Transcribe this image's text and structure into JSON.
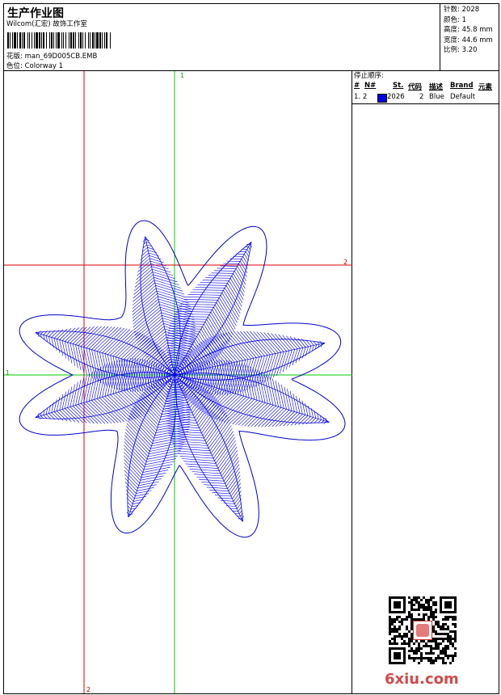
{
  "header": {
    "title": "生产作业图",
    "company": "Wilcom(汇宏) 故饰工作室",
    "design_label": "花版:",
    "design_value": "man_69D005CB.EMB",
    "colorway_label": "色位:",
    "colorway_value": "Colorway 1"
  },
  "specs": [
    {
      "label": "针数:",
      "value": "2028"
    },
    {
      "label": "颜色:",
      "value": "1"
    },
    {
      "label": "高度:",
      "value": "45.8 mm"
    },
    {
      "label": "宽度:",
      "value": "44.6 mm"
    },
    {
      "label": "比例:",
      "value": "3.20"
    }
  ],
  "stop_sequence": {
    "title": "停止顺序:",
    "columns": [
      "#",
      "N#",
      "St.",
      "代码",
      "描述",
      "Brand",
      "元素"
    ],
    "rows": [
      {
        "index": "1.",
        "needle": "2",
        "stitches": "2026",
        "code": "2",
        "description": "Blue",
        "brand": "Default",
        "color": "#0000e0"
      }
    ]
  },
  "guides": {
    "green_top": "1",
    "green_left": "1",
    "red_right": "2",
    "red_bottom": "2"
  },
  "design": {
    "outline_color": "#0000cc",
    "stitch_color": "#0000ee",
    "guide_green": "#00cc00",
    "guide_red": "#dd0000"
  },
  "watermark": "6xiu.com"
}
